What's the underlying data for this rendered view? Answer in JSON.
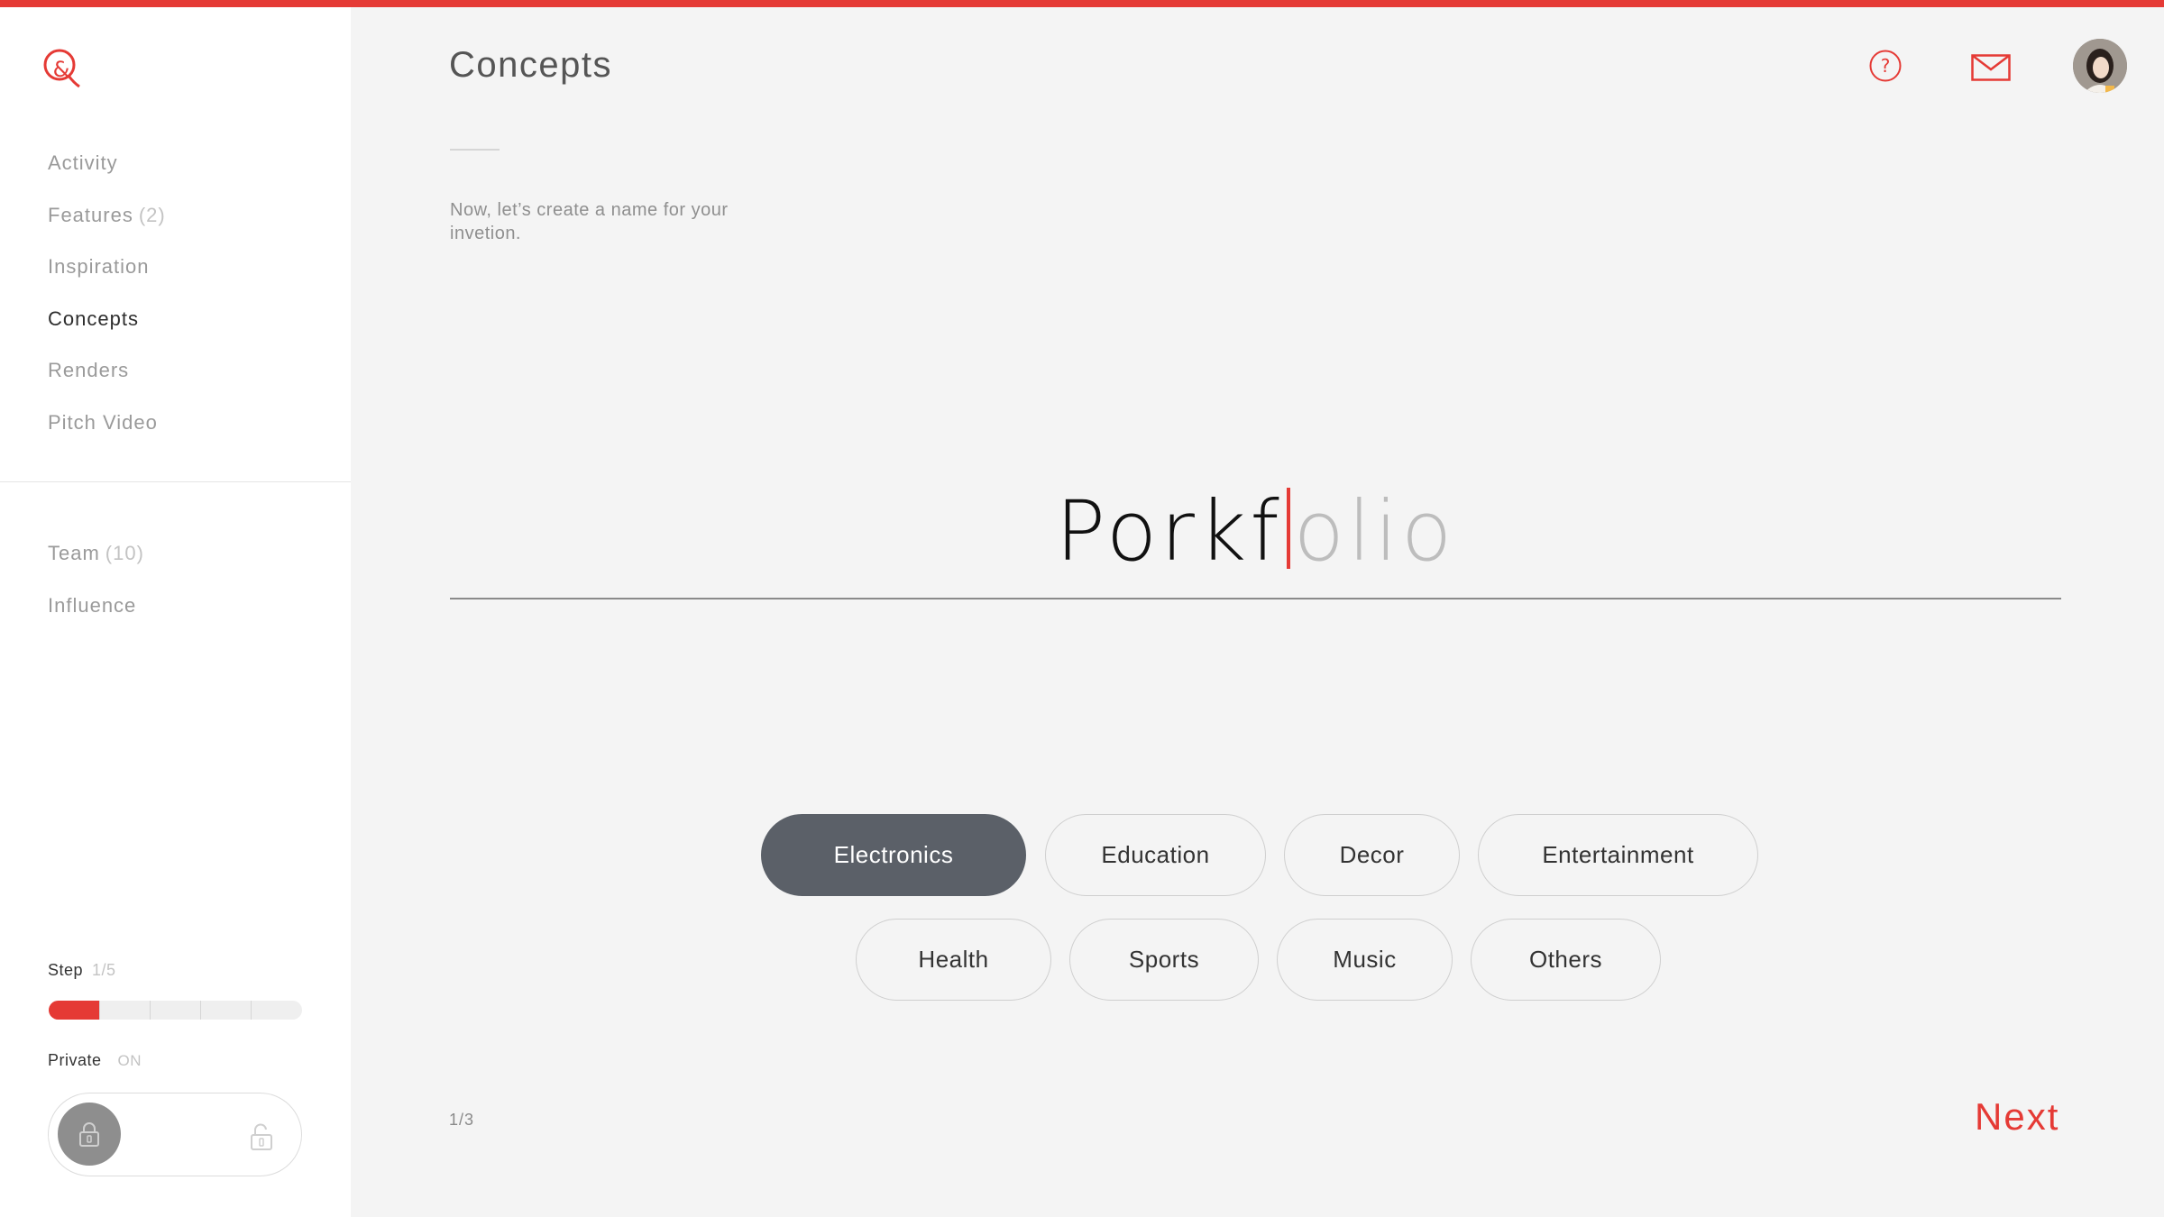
{
  "brand": {
    "logo_icon": "ampersand-logo-icon",
    "accent": "#e53a35"
  },
  "sidebar": {
    "primary_items": [
      {
        "label": "Activity",
        "count": "",
        "active": false
      },
      {
        "label": "Features",
        "count": "(2)",
        "active": false
      },
      {
        "label": "Inspiration",
        "count": "",
        "active": false
      },
      {
        "label": "Concepts",
        "count": "",
        "active": true
      },
      {
        "label": "Renders",
        "count": "",
        "active": false
      },
      {
        "label": "Pitch Video",
        "count": "",
        "active": false
      }
    ],
    "secondary_items": [
      {
        "label": "Team",
        "count": "(10)"
      },
      {
        "label": "Influence",
        "count": ""
      }
    ],
    "step": {
      "label": "Step",
      "value": "1/5",
      "progress": 0.2
    },
    "privacy": {
      "label": "Private",
      "state": "ON"
    }
  },
  "header": {
    "title": "Concepts",
    "help_icon": "help-icon",
    "mail_icon": "mail-icon",
    "avatar": "user-avatar"
  },
  "main": {
    "instruction": "Now, let’s create a name for your invetion.",
    "name_typed": "Porkf",
    "name_suggestion": "olio",
    "categories": [
      {
        "label": "Electronics",
        "selected": true
      },
      {
        "label": "Education",
        "selected": false
      },
      {
        "label": "Decor",
        "selected": false
      },
      {
        "label": "Entertainment",
        "selected": false
      },
      {
        "label": "Health",
        "selected": false
      },
      {
        "label": "Sports",
        "selected": false
      },
      {
        "label": "Music",
        "selected": false
      },
      {
        "label": "Others",
        "selected": false
      }
    ],
    "pager": "1/3",
    "next_label": "Next"
  }
}
